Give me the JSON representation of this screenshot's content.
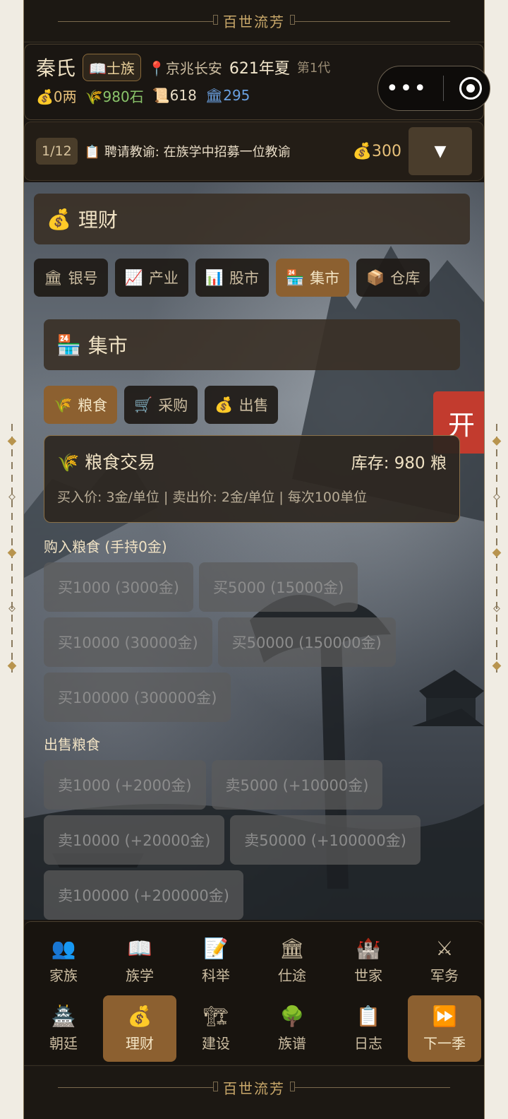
{
  "title_bar": {
    "title": "百世流芳"
  },
  "header": {
    "surname": "秦氏",
    "clan_badge": "📖士族",
    "location": "京兆长安",
    "year": "621年夏",
    "generation": "第1代",
    "resources": {
      "money": "0两",
      "grain": "980石",
      "scroll": "618",
      "bank": "295"
    },
    "colors": {
      "grain": "#8ac46a",
      "bank": "#6aa0e0",
      "money": "#e6c07a"
    }
  },
  "task": {
    "counter": "1/12",
    "text": "聘请教谕: 在族学中招募一位教谕",
    "cost": "300",
    "dropdown": "▼"
  },
  "finance": {
    "title": "理财",
    "tabs": [
      {
        "icon": "🏛",
        "label": "银号"
      },
      {
        "icon": "📈",
        "label": "产业"
      },
      {
        "icon": "📊",
        "label": "股市"
      },
      {
        "icon": "🏪",
        "label": "集市"
      },
      {
        "icon": "📦",
        "label": "仓库"
      }
    ],
    "active_tab": "集市"
  },
  "market": {
    "title": "集市",
    "tabs": [
      {
        "icon": "🌾",
        "label": "粮食"
      },
      {
        "icon": "🛒",
        "label": "采购"
      },
      {
        "icon": "💰",
        "label": "出售"
      }
    ],
    "active_tab": "粮食",
    "card": {
      "title": "粮食交易",
      "stock": "库存: 980 粮",
      "prices": "买入价: 3金/单位 | 卖出价: 2金/单位 | 每次100单位"
    },
    "buy_label": "购入粮食 (手持0金)",
    "buy_buttons": [
      "买1000 (3000金)",
      "买5000 (15000金)",
      "买10000 (30000金)",
      "买50000 (150000金)",
      "买100000 (300000金)"
    ],
    "sell_label": "出售粮食",
    "sell_buttons": [
      "卖1000 (+2000金)",
      "卖5000 (+10000金)",
      "卖10000 (+20000金)",
      "卖50000 (+100000金)",
      "卖100000 (+200000金)"
    ],
    "open_button": "开"
  },
  "bottom_nav": {
    "row1": [
      {
        "icon": "👥",
        "label": "家族"
      },
      {
        "icon": "📖",
        "label": "族学"
      },
      {
        "icon": "📝",
        "label": "科举"
      },
      {
        "icon": "🏛",
        "label": "仕途"
      },
      {
        "icon": "🏰",
        "label": "世家"
      },
      {
        "icon": "⚔",
        "label": "军务"
      }
    ],
    "row2": [
      {
        "icon": "🏯",
        "label": "朝廷"
      },
      {
        "icon": "💰",
        "label": "理财"
      },
      {
        "icon": "🏗",
        "label": "建设"
      },
      {
        "icon": "🌳",
        "label": "族谱"
      },
      {
        "icon": "📋",
        "label": "日志"
      },
      {
        "icon": "⏩",
        "label": "下一季"
      }
    ],
    "active": "理财"
  }
}
